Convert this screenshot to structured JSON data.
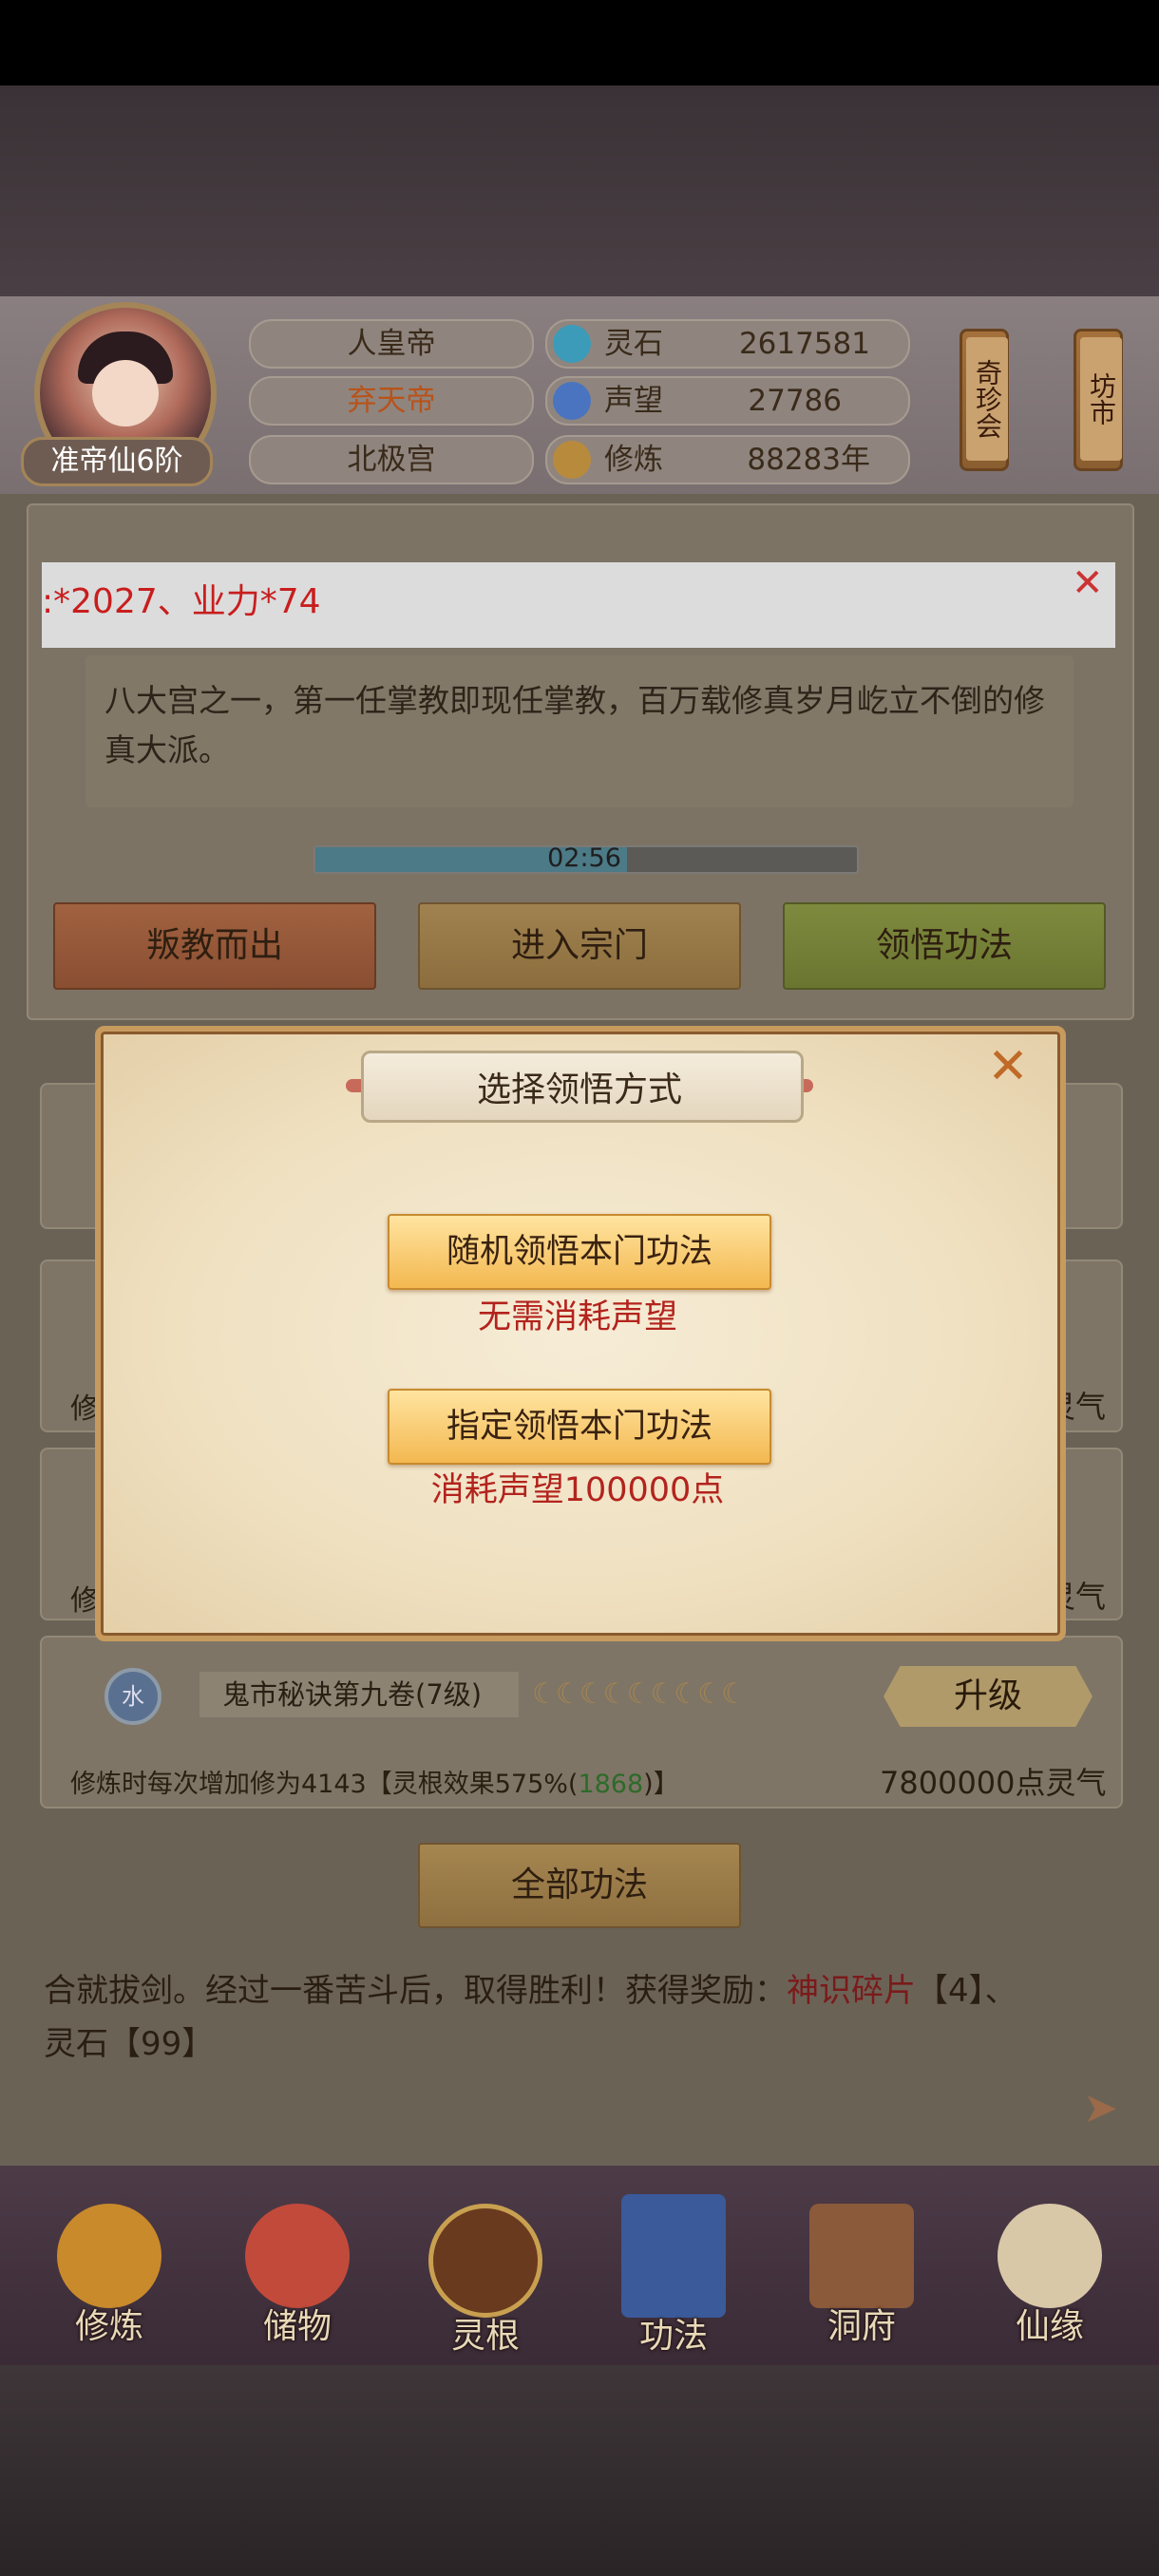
{
  "header": {
    "rank_label": "准帝仙6阶",
    "titles": [
      "人皇帝",
      "弃天帝",
      "北极宫"
    ],
    "highlighted_title_color": "#b8531b",
    "resources": [
      {
        "label": "灵石",
        "value": "2617581",
        "icon": "spirit-stone-icon"
      },
      {
        "label": "声望",
        "value": "27786",
        "icon": "prestige-icon"
      },
      {
        "label": "修炼",
        "value": "88283年",
        "icon": "meditation-icon"
      }
    ],
    "scrolls": [
      "奇珍会",
      "坊市"
    ]
  },
  "notice": {
    "text": ":*2027、业力*74",
    "close_icon": "close-icon"
  },
  "sect": {
    "description": "八大宫之一，第一任掌教即现任掌教，百万载修真岁月屹立不倒的修真大派。",
    "timer": "02:56",
    "timer_progress": 0.58,
    "buttons": {
      "leave": "叛教而出",
      "enter": "进入宗门",
      "comprehend": "领悟功法"
    }
  },
  "modal": {
    "title": "选择领悟方式",
    "random_button": "随机领悟本门功法",
    "random_note": "无需消耗声望",
    "specific_button": "指定领悟本门功法",
    "specific_note": "消耗声望100000点"
  },
  "skills": [
    {
      "prefix": "修",
      "suffix": "灵气"
    },
    {
      "prefix": "修",
      "suffix": "灵气"
    },
    {
      "element": "水",
      "name": "鬼市秘诀第九卷(7级)",
      "upgrade": "升级",
      "desc_prefix": "修炼时每次增加修为4143【灵根效果575%(",
      "desc_highlight": "1868",
      "desc_suffix": ")】",
      "cost": "7800000点灵气",
      "level_marks": 9
    }
  ],
  "all_skills_button": "全部功法",
  "log": {
    "part1": "合就拔剑。经过一番苦斗后，取得胜利！获得奖励：",
    "item1": "神识碎片",
    "part2": "【4】、",
    "part3": "灵石【99】"
  },
  "nav": [
    {
      "label": "修炼",
      "icon": "cultivate-icon"
    },
    {
      "label": "储物",
      "icon": "storage-bag-icon"
    },
    {
      "label": "灵根",
      "icon": "spirit-root-icon"
    },
    {
      "label": "功法",
      "icon": "technique-book-icon"
    },
    {
      "label": "洞府",
      "icon": "cave-abode-icon"
    },
    {
      "label": "仙缘",
      "icon": "immortal-fate-icon"
    }
  ]
}
